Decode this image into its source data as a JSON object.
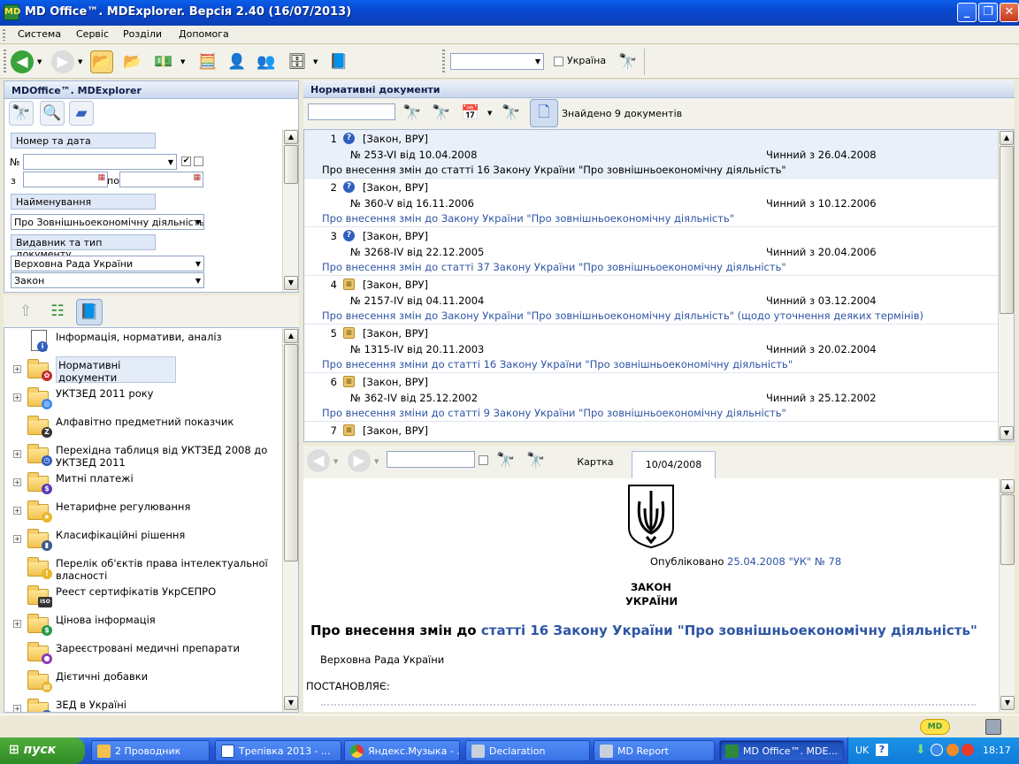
{
  "window": {
    "title": "MD Office™. MDExplorer. Версія 2.40 (16/07/2013)",
    "app_icon": "app-logo-icon"
  },
  "menu": [
    "Система",
    "Сервіс",
    "Розділи",
    "Допомога"
  ],
  "toolbar": {
    "ukraine_label": "Україна",
    "filter_value": ""
  },
  "left_panel": {
    "title": "MDOffice™. MDExplorer",
    "number_date_label": "Номер та дата",
    "no_label": "№",
    "from_label": "з",
    "to_label": "по",
    "name_label": "Найменування",
    "name_value": "Про Зовнішньоекономічну діяльність",
    "publisher_label": "Видавник та тип документу",
    "publisher_value": "Верховна Рада України",
    "type_value": "Закон"
  },
  "tree": [
    {
      "label": "Інформація, нормативи, аналіз",
      "icon": "info-doc-icon",
      "expandable": false
    },
    {
      "label": "Нормативні документи",
      "icon": "folder-seal-icon",
      "expandable": true,
      "selected": true
    },
    {
      "label": "УКТЗЕД 2011 року",
      "icon": "folder-globe-icon",
      "expandable": true
    },
    {
      "label": "Алфавітно предметний показчик",
      "icon": "folder-az-icon",
      "expandable": false
    },
    {
      "label": "Перехідна таблиця від УКТЗЕД 2008 до УКТЗЕД 2011",
      "icon": "folder-clock-icon",
      "expandable": true
    },
    {
      "label": "Митні платежі",
      "icon": "folder-payment-icon",
      "expandable": true
    },
    {
      "label": "Нетарифне регулювання",
      "icon": "folder-star-icon",
      "expandable": true
    },
    {
      "label": "Класифікаційні рішення",
      "icon": "folder-book-icon",
      "expandable": true
    },
    {
      "label": "Перелік об'єктів права інтелектуальної власності",
      "icon": "folder-warning-icon",
      "expandable": false
    },
    {
      "label": "Реест сертифікатів УкрСЕПРО",
      "icon": "folder-iso-icon",
      "expandable": false
    },
    {
      "label": "Цінова інформація",
      "icon": "folder-dollar-icon",
      "expandable": true
    },
    {
      "label": "Зареєстровані медичні препарати",
      "icon": "folder-pill-icon",
      "expandable": false
    },
    {
      "label": "Дієтичні добавки",
      "icon": "folder-cheese-icon",
      "expandable": false
    },
    {
      "label": "ЗЕД в Україні",
      "icon": "folder-book-icon",
      "expandable": true
    }
  ],
  "docs_panel": {
    "title": "Нормативні документи",
    "found_text": "Знайдено 9 документів",
    "rows": [
      {
        "num": "1",
        "icon": "question",
        "kind": "[Закон, ВРУ]",
        "no": "№ 253-VI від 10.04.2008",
        "status": "Чинний з 26.04.2008",
        "title": "Про внесення змін до статті 16 Закону України \"Про зовнішньоекономічну діяльність\"",
        "selected": true
      },
      {
        "num": "2",
        "icon": "question",
        "kind": "[Закон, ВРУ]",
        "no": "№ 360-V від 16.11.2006",
        "status": "Чинний з 10.12.2006",
        "title": "Про внесення змін до Закону України \"Про зовнішньоекономічну діяльність\""
      },
      {
        "num": "3",
        "icon": "question",
        "kind": "[Закон, ВРУ]",
        "no": "№ 3268-IV від 22.12.2005",
        "status": "Чинний з 20.04.2006",
        "title": "Про внесення змін до статті 37 Закону України \"Про зовнішньоекономічну діяльність\""
      },
      {
        "num": "4",
        "icon": "scroll",
        "kind": "[Закон, ВРУ]",
        "no": "№ 2157-IV від 04.11.2004",
        "status": "Чинний з 03.12.2004",
        "title": "Про внесення змін до Закону України \"Про зовнішньоекономічну діяльність\" (щодо уточнення деяких термінів)"
      },
      {
        "num": "5",
        "icon": "scroll",
        "kind": "[Закон, ВРУ]",
        "no": "№ 1315-IV від 20.11.2003",
        "status": "Чинний з 20.02.2004",
        "title": "Про внесення зміни до статті 16 Закону України \"Про зовнішньоекономічну діяльність\""
      },
      {
        "num": "6",
        "icon": "scroll",
        "kind": "[Закон, ВРУ]",
        "no": "№ 362-IV від 25.12.2002",
        "status": "Чинний з 25.12.2002",
        "title": "Про внесення зміни до статті 9 Закону України \"Про зовнішньоекономічну діяльність\""
      },
      {
        "num": "7",
        "icon": "scroll",
        "kind": "[Закон, ВРУ]",
        "no": "",
        "status": "",
        "title": ""
      }
    ]
  },
  "viewer": {
    "tab_card": "Картка",
    "tab_date": "10/04/2008",
    "published_prefix": "Опубліковано",
    "published_link": "25.04.2008 \"УК\" № 78",
    "law_word": "ЗАКОН",
    "country_word": "УКРАЇНИ",
    "heading_prefix": "Про внесення змін до",
    "heading_link": "статті 16 Закону України \"Про зовнішньоекономічну діяльність\"",
    "body_line1": "Верховна Рада України",
    "body_line2": "ПОСТАНОВЛЯЄ:"
  },
  "taskbar": {
    "start": "пуск",
    "tasks": [
      "2 Проводник",
      "Трепівка 2013 - ...",
      "Яндекс.Музыка - ...",
      "Declaration",
      "MD Report",
      "MD Office™. MDE..."
    ],
    "lang": "UK",
    "clock": "18:17"
  }
}
